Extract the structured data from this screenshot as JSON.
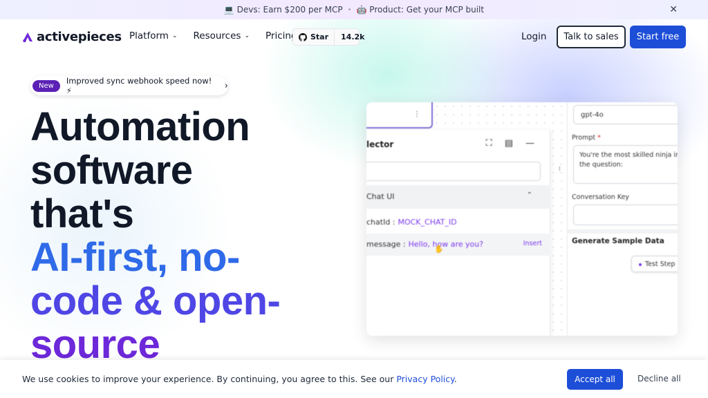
{
  "announcement": {
    "item1": "💻 Devs: Earn $200 per MCP",
    "separator": "•",
    "item2": "🤖 Product: Get your MCP built",
    "close_icon": "close-icon"
  },
  "header": {
    "logo_text": "activepieces",
    "nav": [
      {
        "label": "Platform",
        "has_dropdown": true
      },
      {
        "label": "Resources",
        "has_dropdown": true
      },
      {
        "label": "Pricing",
        "has_dropdown": false
      }
    ],
    "github": {
      "star_label": "Star",
      "count": "14.2k"
    },
    "login_label": "Login",
    "talk_label": "Talk to sales",
    "start_label": "Start free"
  },
  "pill": {
    "badge": "New",
    "text": "Improved sync webhook speed now! ⚡",
    "arrow": "›"
  },
  "hero": {
    "line1": "Automation",
    "line2": "software",
    "line3": "that's",
    "line4": "AI-first, no-",
    "line5": "code & open-",
    "line6": "source"
  },
  "preview": {
    "left_panel": {
      "title": "lector",
      "group": "Chat UI",
      "rows": [
        {
          "key": "chatId :",
          "value": "MOCK_CHAT_ID",
          "insert": ""
        },
        {
          "key": "message :",
          "value": "Hello, how are you?",
          "insert": "Insert"
        }
      ]
    },
    "right_panel": {
      "model": "gpt-4o",
      "prompt_label": "Prompt",
      "prompt_required": "*",
      "prompt_text": "You're the most skilled ninja in the question:",
      "conversation_label": "Conversation Key",
      "generate_label": "Generate Sample Data",
      "test_step": "Test Step"
    }
  },
  "cookie": {
    "message": "We use cookies to improve your experience. By continuing, you agree to this. See our",
    "link": "Privacy Policy",
    "period": ".",
    "accept": "Accept all",
    "decline": "Decline all"
  },
  "colors": {
    "primary": "#1d4ed8",
    "badge": "#5b21b6",
    "hero_dark": "#111827",
    "hero_blue": "#2f6ae8",
    "hero_purple": "#6d28d9"
  }
}
